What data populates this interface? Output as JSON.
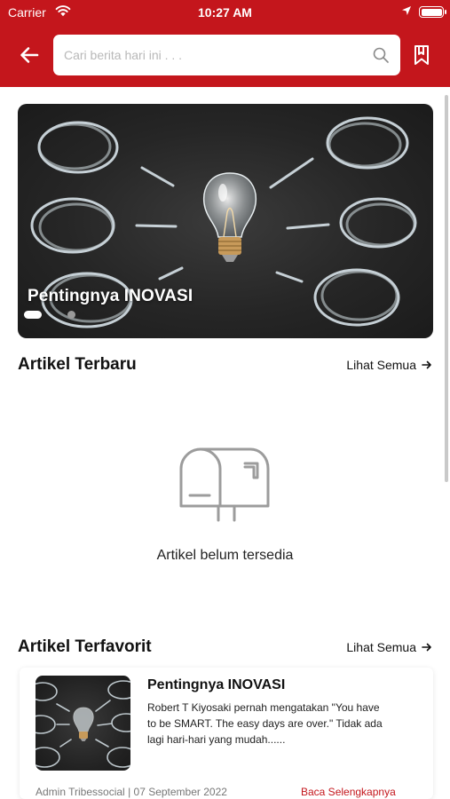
{
  "status_bar": {
    "carrier": "Carrier",
    "time": "10:27 AM"
  },
  "header": {
    "search_placeholder": "Cari berita hari ini . . .",
    "accent_color": "#c4161c",
    "icons": [
      "arrow-left-icon",
      "search-icon",
      "bookmark-icon"
    ]
  },
  "banner": {
    "title": "Pentingnya INOVASI",
    "slide_count": 2,
    "active_slide": 1
  },
  "latest": {
    "title": "Artikel Terbaru",
    "see_all": "Lihat Semua",
    "empty_message": "Artikel belum tersedia",
    "empty_icon": "mailbox-icon"
  },
  "favorites": {
    "title": "Artikel Terfavorit",
    "see_all": "Lihat Semua",
    "items": [
      {
        "title": "Pentingnya INOVASI",
        "excerpt": "Robert T Kiyosaki pernah mengatakan \"You have to be SMART. The easy days are over.\" Tidak ada lagi hari-hari yang mudah......",
        "author": "Admin Tribessocial",
        "date": "07 September 2022",
        "read_more": "Baca Selengkapnya"
      }
    ]
  }
}
